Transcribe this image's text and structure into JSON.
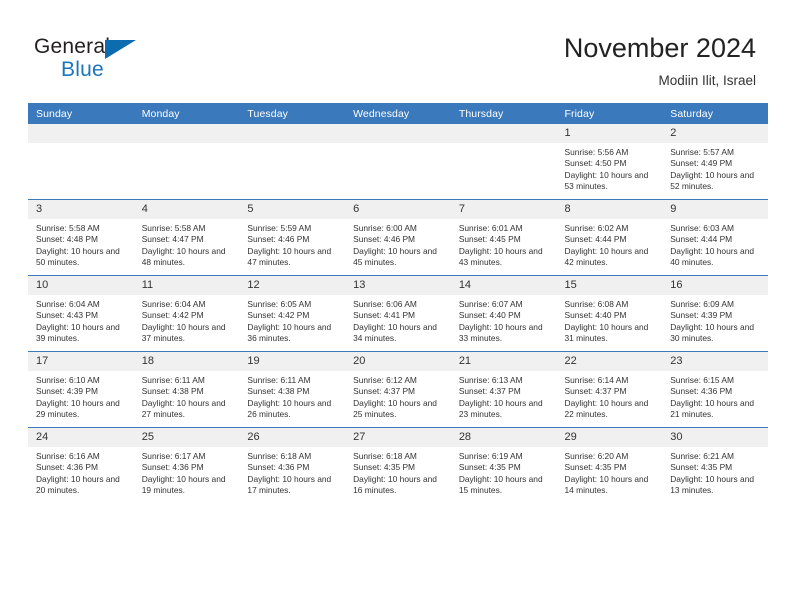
{
  "brand": {
    "name_part1": "General",
    "name_part2": "Blue",
    "accent_color": "#1b75bb",
    "triangle_color": "#0d6bb0"
  },
  "header": {
    "title": "November 2024",
    "subtitle": "Modiin Ilit, Israel"
  },
  "theme": {
    "header_blue": "#3b79bd",
    "daynum_bg": "#f0f0f0",
    "text": "#333333"
  },
  "weekdays": [
    "Sunday",
    "Monday",
    "Tuesday",
    "Wednesday",
    "Thursday",
    "Friday",
    "Saturday"
  ],
  "weeks": [
    [
      {
        "day": "",
        "sunrise": "",
        "sunset": "",
        "daylight": ""
      },
      {
        "day": "",
        "sunrise": "",
        "sunset": "",
        "daylight": ""
      },
      {
        "day": "",
        "sunrise": "",
        "sunset": "",
        "daylight": ""
      },
      {
        "day": "",
        "sunrise": "",
        "sunset": "",
        "daylight": ""
      },
      {
        "day": "",
        "sunrise": "",
        "sunset": "",
        "daylight": ""
      },
      {
        "day": "1",
        "sunrise": "Sunrise: 5:56 AM",
        "sunset": "Sunset: 4:50 PM",
        "daylight": "Daylight: 10 hours and 53 minutes."
      },
      {
        "day": "2",
        "sunrise": "Sunrise: 5:57 AM",
        "sunset": "Sunset: 4:49 PM",
        "daylight": "Daylight: 10 hours and 52 minutes."
      }
    ],
    [
      {
        "day": "3",
        "sunrise": "Sunrise: 5:58 AM",
        "sunset": "Sunset: 4:48 PM",
        "daylight": "Daylight: 10 hours and 50 minutes."
      },
      {
        "day": "4",
        "sunrise": "Sunrise: 5:58 AM",
        "sunset": "Sunset: 4:47 PM",
        "daylight": "Daylight: 10 hours and 48 minutes."
      },
      {
        "day": "5",
        "sunrise": "Sunrise: 5:59 AM",
        "sunset": "Sunset: 4:46 PM",
        "daylight": "Daylight: 10 hours and 47 minutes."
      },
      {
        "day": "6",
        "sunrise": "Sunrise: 6:00 AM",
        "sunset": "Sunset: 4:46 PM",
        "daylight": "Daylight: 10 hours and 45 minutes."
      },
      {
        "day": "7",
        "sunrise": "Sunrise: 6:01 AM",
        "sunset": "Sunset: 4:45 PM",
        "daylight": "Daylight: 10 hours and 43 minutes."
      },
      {
        "day": "8",
        "sunrise": "Sunrise: 6:02 AM",
        "sunset": "Sunset: 4:44 PM",
        "daylight": "Daylight: 10 hours and 42 minutes."
      },
      {
        "day": "9",
        "sunrise": "Sunrise: 6:03 AM",
        "sunset": "Sunset: 4:44 PM",
        "daylight": "Daylight: 10 hours and 40 minutes."
      }
    ],
    [
      {
        "day": "10",
        "sunrise": "Sunrise: 6:04 AM",
        "sunset": "Sunset: 4:43 PM",
        "daylight": "Daylight: 10 hours and 39 minutes."
      },
      {
        "day": "11",
        "sunrise": "Sunrise: 6:04 AM",
        "sunset": "Sunset: 4:42 PM",
        "daylight": "Daylight: 10 hours and 37 minutes."
      },
      {
        "day": "12",
        "sunrise": "Sunrise: 6:05 AM",
        "sunset": "Sunset: 4:42 PM",
        "daylight": "Daylight: 10 hours and 36 minutes."
      },
      {
        "day": "13",
        "sunrise": "Sunrise: 6:06 AM",
        "sunset": "Sunset: 4:41 PM",
        "daylight": "Daylight: 10 hours and 34 minutes."
      },
      {
        "day": "14",
        "sunrise": "Sunrise: 6:07 AM",
        "sunset": "Sunset: 4:40 PM",
        "daylight": "Daylight: 10 hours and 33 minutes."
      },
      {
        "day": "15",
        "sunrise": "Sunrise: 6:08 AM",
        "sunset": "Sunset: 4:40 PM",
        "daylight": "Daylight: 10 hours and 31 minutes."
      },
      {
        "day": "16",
        "sunrise": "Sunrise: 6:09 AM",
        "sunset": "Sunset: 4:39 PM",
        "daylight": "Daylight: 10 hours and 30 minutes."
      }
    ],
    [
      {
        "day": "17",
        "sunrise": "Sunrise: 6:10 AM",
        "sunset": "Sunset: 4:39 PM",
        "daylight": "Daylight: 10 hours and 29 minutes."
      },
      {
        "day": "18",
        "sunrise": "Sunrise: 6:11 AM",
        "sunset": "Sunset: 4:38 PM",
        "daylight": "Daylight: 10 hours and 27 minutes."
      },
      {
        "day": "19",
        "sunrise": "Sunrise: 6:11 AM",
        "sunset": "Sunset: 4:38 PM",
        "daylight": "Daylight: 10 hours and 26 minutes."
      },
      {
        "day": "20",
        "sunrise": "Sunrise: 6:12 AM",
        "sunset": "Sunset: 4:37 PM",
        "daylight": "Daylight: 10 hours and 25 minutes."
      },
      {
        "day": "21",
        "sunrise": "Sunrise: 6:13 AM",
        "sunset": "Sunset: 4:37 PM",
        "daylight": "Daylight: 10 hours and 23 minutes."
      },
      {
        "day": "22",
        "sunrise": "Sunrise: 6:14 AM",
        "sunset": "Sunset: 4:37 PM",
        "daylight": "Daylight: 10 hours and 22 minutes."
      },
      {
        "day": "23",
        "sunrise": "Sunrise: 6:15 AM",
        "sunset": "Sunset: 4:36 PM",
        "daylight": "Daylight: 10 hours and 21 minutes."
      }
    ],
    [
      {
        "day": "24",
        "sunrise": "Sunrise: 6:16 AM",
        "sunset": "Sunset: 4:36 PM",
        "daylight": "Daylight: 10 hours and 20 minutes."
      },
      {
        "day": "25",
        "sunrise": "Sunrise: 6:17 AM",
        "sunset": "Sunset: 4:36 PM",
        "daylight": "Daylight: 10 hours and 19 minutes."
      },
      {
        "day": "26",
        "sunrise": "Sunrise: 6:18 AM",
        "sunset": "Sunset: 4:36 PM",
        "daylight": "Daylight: 10 hours and 17 minutes."
      },
      {
        "day": "27",
        "sunrise": "Sunrise: 6:18 AM",
        "sunset": "Sunset: 4:35 PM",
        "daylight": "Daylight: 10 hours and 16 minutes."
      },
      {
        "day": "28",
        "sunrise": "Sunrise: 6:19 AM",
        "sunset": "Sunset: 4:35 PM",
        "daylight": "Daylight: 10 hours and 15 minutes."
      },
      {
        "day": "29",
        "sunrise": "Sunrise: 6:20 AM",
        "sunset": "Sunset: 4:35 PM",
        "daylight": "Daylight: 10 hours and 14 minutes."
      },
      {
        "day": "30",
        "sunrise": "Sunrise: 6:21 AM",
        "sunset": "Sunset: 4:35 PM",
        "daylight": "Daylight: 10 hours and 13 minutes."
      }
    ]
  ]
}
